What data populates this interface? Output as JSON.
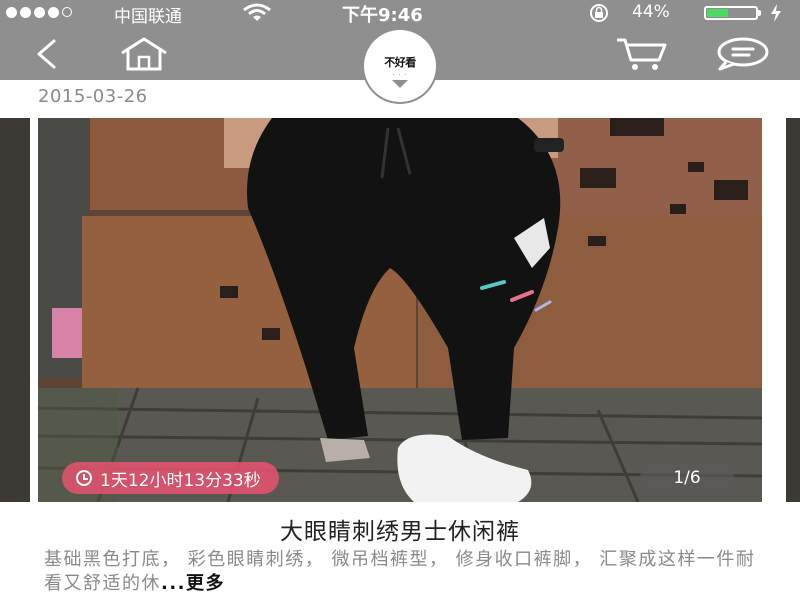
{
  "status_bar": {
    "signal_dots": 5,
    "signal_filled": 4,
    "carrier": "中国联通",
    "time": "下午9:46",
    "battery_percent": "44%",
    "battery_level": 0.44,
    "battery_color": "#4cd964"
  },
  "nav_bar": {
    "background": "#8f8f8f",
    "back_icon": "back-chevron-icon",
    "home_icon": "home-icon",
    "cart_icon": "cart-icon",
    "chat_icon": "chat-bubble-icon",
    "logo_text": "不好看"
  },
  "post": {
    "date": "2015-03-26",
    "countdown": "1天12小时13分33秒",
    "countdown_color": "#e75270",
    "image_position": "1/6",
    "title": "大眼睛刺绣男士休闲裤",
    "description": "基础黑色打底， 彩色眼睛刺绣， 微吊档裤型， 修身收口裤脚， 汇聚成这样一件耐看又舒适的休",
    "ellipsis": "...",
    "more_label": "更多"
  }
}
